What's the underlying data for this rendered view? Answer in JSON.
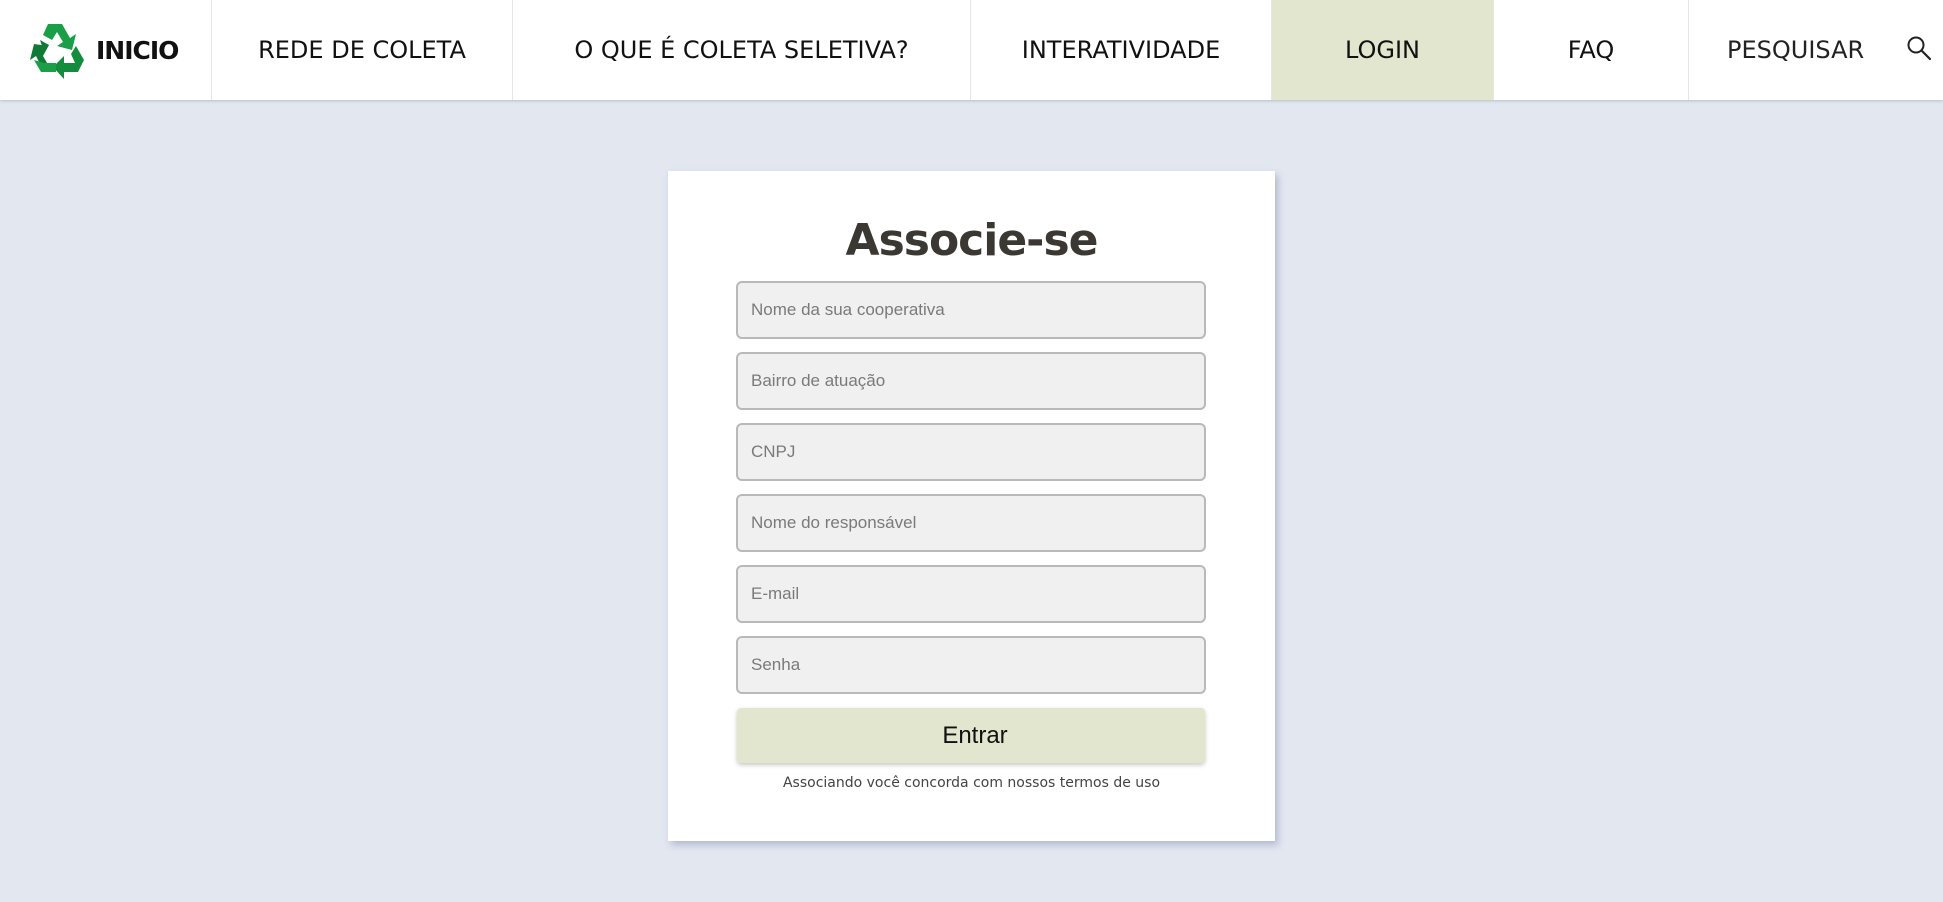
{
  "nav": {
    "brand_label": "INICIO",
    "items": [
      {
        "label": "REDE DE COLETA"
      },
      {
        "label": "O QUE É COLETA SELETIVA?"
      },
      {
        "label": "INTERATIVIDADE"
      },
      {
        "label": "LOGIN",
        "active": true
      },
      {
        "label": "FAQ"
      }
    ],
    "search_label": "PESQUISAR",
    "search_icon": "search-icon",
    "logo_icon": "recycle-icon"
  },
  "form": {
    "title": "Associe-se",
    "fields": [
      {
        "placeholder": "Nome da sua cooperativa",
        "value": ""
      },
      {
        "placeholder": "Bairro de atuação",
        "value": ""
      },
      {
        "placeholder": "CNPJ",
        "value": ""
      },
      {
        "placeholder": "Nome do responsável",
        "value": ""
      },
      {
        "placeholder": "E-mail",
        "value": ""
      },
      {
        "placeholder": "Senha",
        "value": ""
      }
    ],
    "submit_label": "Entrar",
    "terms_text": "Associando você concorda com nossos termos de uso"
  },
  "colors": {
    "background": "#e3e7f0",
    "active_tab": "#e2e6cf",
    "button": "#e2e6cf",
    "logo_green": "#1a9e48",
    "logo_green_dark": "#0f7a35"
  }
}
